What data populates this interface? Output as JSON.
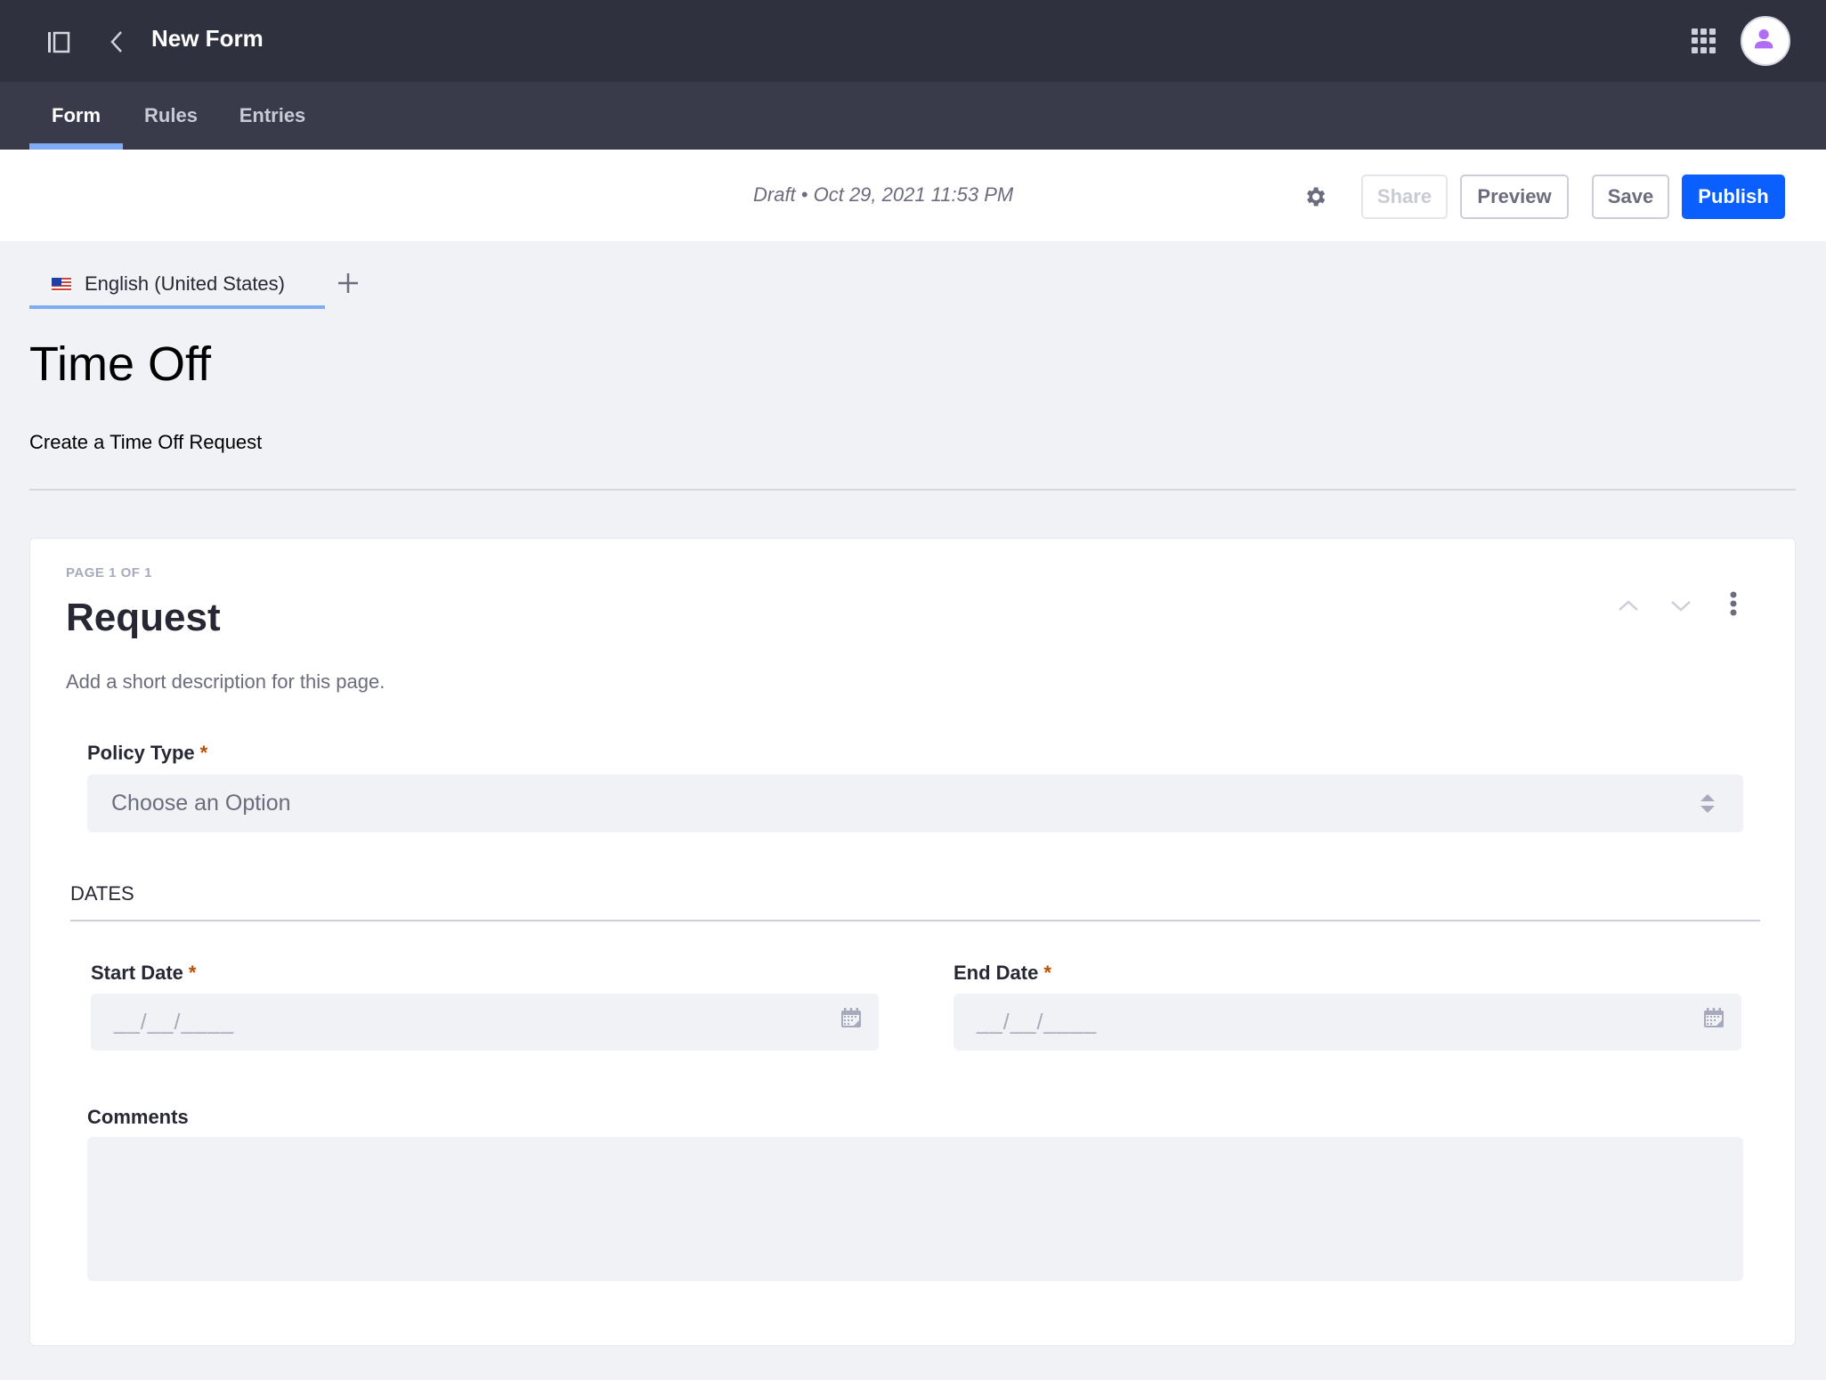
{
  "header": {
    "title": "New Form",
    "icons": {
      "sidebar": "sidebar-toggle-icon",
      "back": "chevron-left-icon",
      "apps": "apps-grid-icon",
      "user": "user-avatar-icon"
    }
  },
  "tabs": [
    {
      "label": "Form",
      "active": true
    },
    {
      "label": "Rules",
      "active": false
    },
    {
      "label": "Entries",
      "active": false
    }
  ],
  "toolbar": {
    "status": "Draft • Oct 29, 2021 11:53 PM",
    "settings_icon": "gear-icon",
    "share_label": "Share",
    "preview_label": "Preview",
    "save_label": "Save",
    "publish_label": "Publish"
  },
  "language": {
    "current": "English (United States)",
    "flag": "us-flag-icon",
    "add_icon": "plus-icon"
  },
  "form": {
    "title": "Time Off",
    "description": "Create a Time Off Request"
  },
  "page": {
    "count_label": "PAGE 1 OF 1",
    "title": "Request",
    "description": "Add a short description for this page."
  },
  "fields": {
    "policy_type": {
      "label": "Policy Type",
      "required": "*",
      "placeholder": "Choose an Option"
    },
    "dates_section": "DATES",
    "start_date": {
      "label": "Start Date",
      "required": "*",
      "mask": "__/__/____"
    },
    "end_date": {
      "label": "End Date",
      "required": "*",
      "mask": "__/__/____"
    },
    "comments": {
      "label": "Comments",
      "value": ""
    }
  },
  "colors": {
    "header_bg": "#30313f",
    "tabbar_bg": "#393a4a",
    "accent": "#0b5fff",
    "tab_indicator": "#80acf5",
    "required": "#b95000",
    "avatar": "#b06ef5"
  }
}
